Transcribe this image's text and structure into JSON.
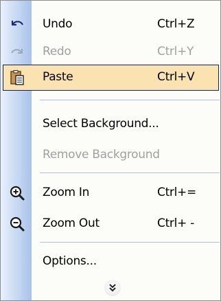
{
  "menu": {
    "items": [
      {
        "label": "Undo",
        "shortcut": "Ctrl+Z",
        "icon": "undo-icon",
        "enabled": true
      },
      {
        "label": "Redo",
        "shortcut": "Ctrl+Y",
        "icon": "redo-icon",
        "enabled": false
      },
      {
        "label": "Paste",
        "shortcut": "Ctrl+V",
        "icon": "paste-icon",
        "enabled": true,
        "selected": true
      },
      {
        "label": "Select Background...",
        "enabled": true
      },
      {
        "label": "Remove Background",
        "enabled": false
      },
      {
        "label": "Zoom In",
        "shortcut": "Ctrl+=",
        "icon": "zoom-in-icon",
        "enabled": true
      },
      {
        "label": "Zoom Out",
        "shortcut": "Ctrl+ -",
        "icon": "zoom-out-icon",
        "enabled": true
      },
      {
        "label": "Options...",
        "enabled": true
      }
    ],
    "expand_icon": "double-chevron-down-icon"
  },
  "colors": {
    "highlight_fill": "#fbe3b1",
    "highlight_border": "#0a2464",
    "gutter": "#c6d8f3",
    "separator": "#a9c0e3",
    "disabled_text": "#a0a0a0"
  }
}
